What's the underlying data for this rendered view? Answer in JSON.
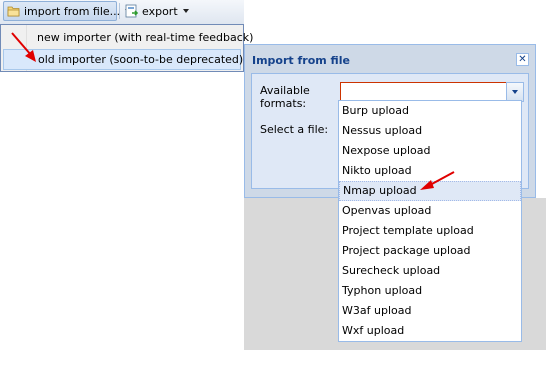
{
  "toolbar": {
    "import_label": "import from file...",
    "export_label": "export",
    "import_icon": "folder-icon",
    "export_icon": "export-icon"
  },
  "import_menu": {
    "items": [
      {
        "label": "new importer (with real-time feedback)"
      },
      {
        "label": "old importer (soon-to-be deprecated)",
        "highlighted": true
      }
    ]
  },
  "window": {
    "title": "Import from file",
    "close_icon": "close-icon",
    "formats_label": "Available formats:",
    "file_label": "Select a file:",
    "formats_value": "",
    "trigger_icon": "chevron-down-icon"
  },
  "format_list": {
    "items": [
      "Burp upload",
      "Nessus upload",
      "Nexpose upload",
      "Nikto upload",
      "Nmap upload",
      "Openvas upload",
      "Project template upload",
      "Project package upload",
      "Surecheck upload",
      "Typhon upload",
      "W3af upload",
      "Wxf upload"
    ],
    "selected": "Nmap upload"
  },
  "colors": {
    "annotation_arrow": "#e00000",
    "window_title": "#15428b",
    "panel_bg": "#dfe8f6",
    "invalid_border": "#cc3300"
  }
}
